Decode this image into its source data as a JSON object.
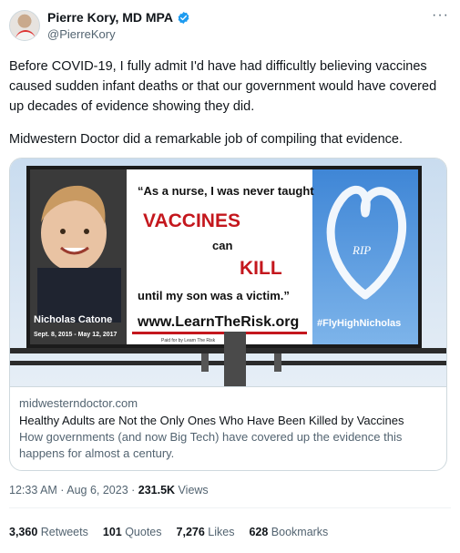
{
  "author": {
    "name": "Pierre Kory, MD MPA",
    "handle": "@PierreKory"
  },
  "tweet": {
    "paragraph1": "Before COVID-19, I fully admit I'd have had difficultly believing vaccines caused sudden infant deaths or that our government would have covered up decades of evidence showing they did.",
    "paragraph2": "Midwestern Doctor did a remarkable job of compiling that evidence."
  },
  "card": {
    "billboard": {
      "quote_line1": "“As a nurse, I was never taught",
      "quote_vaccines": "VACCINES",
      "quote_can": "can",
      "quote_kill": "KILL",
      "quote_line4": "until my son was a victim.”",
      "url": "www.LearnTheRisk.org",
      "paid_for": "Paid for by Learn The Risk",
      "child_name": "Nicholas Catone",
      "child_dates": "Sept. 8, 2015 - May 12, 2017",
      "rip": "RIP",
      "hashtag": "#FlyHighNicholas"
    },
    "domain": "midwesterndoctor.com",
    "title": "Healthy Adults are Not the Only Ones Who Have Been Killed by Vaccines",
    "description": "How governments (and now Big Tech) have covered up the evidence this happens for almost a century."
  },
  "meta": {
    "time": "12:33 AM · Aug 6, 2023 · ",
    "views_count": "231.5K",
    "views_label": " Views"
  },
  "stats": {
    "retweets_count": "3,360",
    "retweets_label": " Retweets",
    "quotes_count": "101",
    "quotes_label": " Quotes",
    "likes_count": "7,276",
    "likes_label": " Likes",
    "bookmarks_count": "628",
    "bookmarks_label": " Bookmarks"
  },
  "colors": {
    "verified": "#1d9bf0",
    "billboard_red": "#c4171d",
    "sky_blue": "#5b9fe3"
  }
}
